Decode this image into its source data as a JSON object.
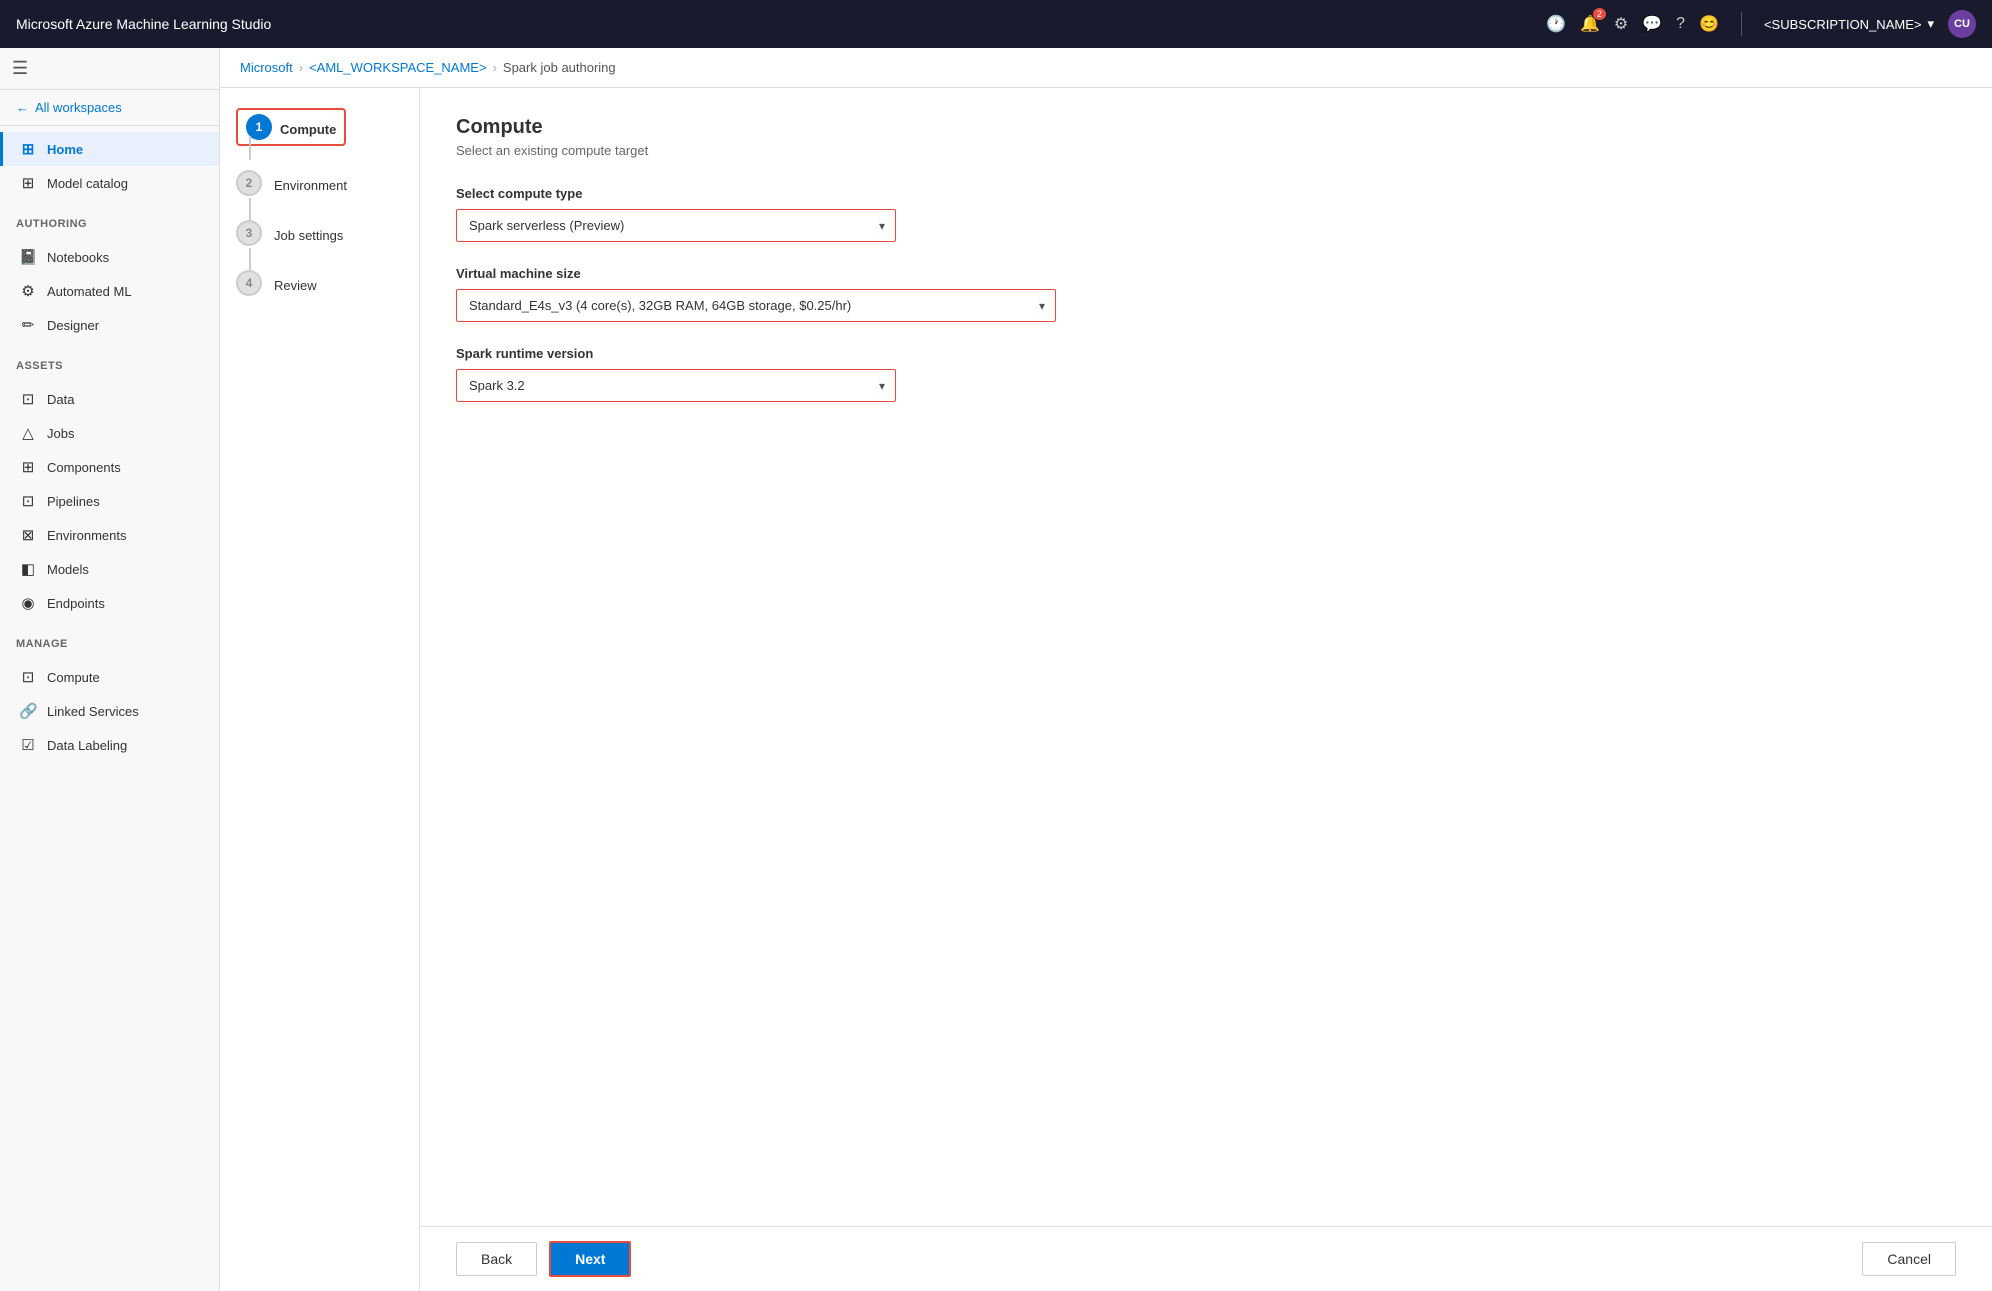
{
  "app": {
    "title": "Microsoft Azure Machine Learning Studio"
  },
  "topnav": {
    "title": "Microsoft Azure Machine Learning Studio",
    "notification_count": "2",
    "account_name": "<SUBSCRIPTION_NAME>",
    "avatar_text": "CU"
  },
  "breadcrumb": {
    "items": [
      {
        "label": "Microsoft",
        "link": true
      },
      {
        "label": "<AML_WORKSPACE_NAME>",
        "link": true
      },
      {
        "label": "Spark job authoring",
        "link": false
      }
    ]
  },
  "sidebar": {
    "all_workspaces_label": "All workspaces",
    "sections": [
      {
        "items": [
          {
            "id": "home",
            "label": "Home",
            "icon": "⊞",
            "active": true
          }
        ]
      },
      {
        "items": [
          {
            "id": "model-catalog",
            "label": "Model catalog",
            "icon": "⊞"
          }
        ]
      },
      {
        "section_label": "Authoring",
        "items": [
          {
            "id": "notebooks",
            "label": "Notebooks",
            "icon": "📓"
          },
          {
            "id": "automated-ml",
            "label": "Automated ML",
            "icon": "⚙"
          },
          {
            "id": "designer",
            "label": "Designer",
            "icon": "✏"
          }
        ]
      },
      {
        "section_label": "Assets",
        "items": [
          {
            "id": "data",
            "label": "Data",
            "icon": "⊡"
          },
          {
            "id": "jobs",
            "label": "Jobs",
            "icon": "△"
          },
          {
            "id": "components",
            "label": "Components",
            "icon": "⊞"
          },
          {
            "id": "pipelines",
            "label": "Pipelines",
            "icon": "⊡"
          },
          {
            "id": "environments",
            "label": "Environments",
            "icon": "⊠"
          },
          {
            "id": "models",
            "label": "Models",
            "icon": "◧"
          },
          {
            "id": "endpoints",
            "label": "Endpoints",
            "icon": "◉"
          }
        ]
      },
      {
        "section_label": "Manage",
        "items": [
          {
            "id": "compute",
            "label": "Compute",
            "icon": "⊡"
          },
          {
            "id": "linked-services",
            "label": "Linked Services",
            "icon": "🔗"
          },
          {
            "id": "data-labeling",
            "label": "Data Labeling",
            "icon": "☑"
          }
        ]
      }
    ]
  },
  "wizard": {
    "steps": [
      {
        "number": "1",
        "label": "Compute",
        "active": true
      },
      {
        "number": "2",
        "label": "Environment",
        "active": false
      },
      {
        "number": "3",
        "label": "Job settings",
        "active": false
      },
      {
        "number": "4",
        "label": "Review",
        "active": false
      }
    ]
  },
  "form": {
    "title": "Compute",
    "subtitle": "Select an existing compute target",
    "compute_type_label": "Select compute type",
    "compute_type_value": "Spark serverless (Preview)",
    "compute_type_options": [
      "Spark serverless (Preview)"
    ],
    "vm_size_label": "Virtual machine size",
    "vm_size_value": "Standard_E4s_v3 (4 core(s), 32GB RAM, 64GB storage, $0.25/hr)",
    "vm_size_options": [
      "Standard_E4s_v3 (4 core(s), 32GB RAM, 64GB storage, $0.25/hr)"
    ],
    "spark_version_label": "Spark runtime version",
    "spark_version_value": "Spark 3.2",
    "spark_version_options": [
      "Spark 3.2"
    ]
  },
  "buttons": {
    "back_label": "Back",
    "next_label": "Next",
    "cancel_label": "Cancel"
  }
}
